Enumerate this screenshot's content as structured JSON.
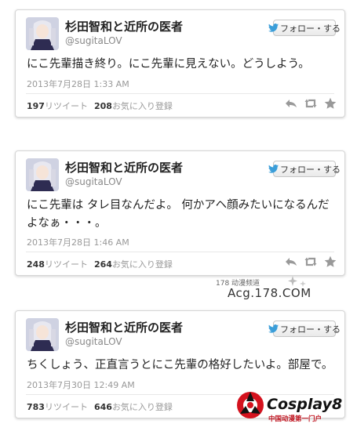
{
  "colors": {
    "link_blue": "#3b9ed9",
    "text": "#222222",
    "muted": "#999999",
    "action_gray": "#999999"
  },
  "tweets": [
    {
      "display_name": "杉田智和と近所の医者",
      "handle": "@sugitaLOV",
      "follow_label": "フォロー・する",
      "text": "にこ先輩描き終り。にこ先輩に見えない。どうしよう。",
      "timestamp": "2013年7月28日 1:33 AM",
      "retweets_count": "197",
      "retweets_label": "リツイート",
      "favorites_count": "208",
      "favorites_label": "お気に入り登録",
      "icons": [
        "reply-icon",
        "retweet-icon",
        "favorite-icon"
      ]
    },
    {
      "display_name": "杉田智和と近所の医者",
      "handle": "@sugitaLOV",
      "follow_label": "フォロー・する",
      "text": "にこ先輩は タレ目なんだよ。 何かアヘ顔みたいになるんだよなぁ・・・。",
      "timestamp": "2013年7月28日 1:46 AM",
      "retweets_count": "248",
      "retweets_label": "リツイート",
      "favorites_count": "264",
      "favorites_label": "お気に入り登録",
      "icons": [
        "reply-icon",
        "retweet-icon",
        "favorite-icon"
      ]
    },
    {
      "display_name": "杉田智和と近所の医者",
      "handle": "@sugitaLOV",
      "follow_label": "フォロー・する",
      "text": "ちくしょう、正直言うとにこ先輩の格好したいよ。部屋で。",
      "timestamp": "2013年7月30日 12:49 AM",
      "retweets_count": "783",
      "retweets_label": "リツイート",
      "favorites_count": "646",
      "favorites_label": "お気に入り登録",
      "icons": [
        "reply-icon",
        "retweet-icon",
        "favorite-icon"
      ]
    }
  ],
  "watermarks": {
    "acg_site": "178 动漫频道",
    "acg_url": "Acg.178.COM",
    "cosplay_name": "Cosplay8",
    "cosplay_sub": "中国动漫第一门户"
  }
}
